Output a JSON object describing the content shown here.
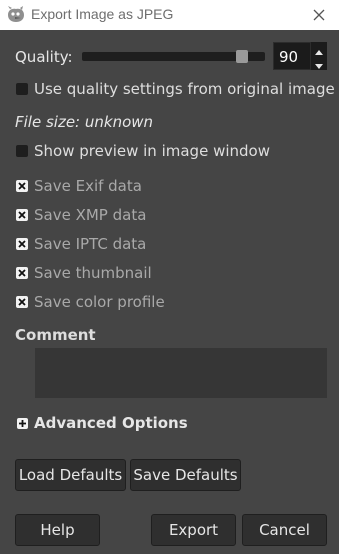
{
  "window": {
    "title": "Export Image as JPEG",
    "app_icon": "gimp-wilber-icon",
    "close_icon": "close-icon"
  },
  "quality": {
    "label": "Quality:",
    "value": "90",
    "slider_value": 90,
    "slider_min": 0,
    "slider_max": 100
  },
  "options": {
    "use_original_quality": {
      "label": "Use quality settings from original image",
      "checked": false
    },
    "file_size": "File size: unknown",
    "show_preview": {
      "label": "Show preview in image window",
      "checked": false
    },
    "save_exif": {
      "label": "Save Exif data",
      "checked": true
    },
    "save_xmp": {
      "label": "Save XMP data",
      "checked": true
    },
    "save_iptc": {
      "label": "Save IPTC data",
      "checked": true
    },
    "save_thumbnail": {
      "label": "Save thumbnail",
      "checked": true
    },
    "save_color_profile": {
      "label": "Save color profile",
      "checked": true
    }
  },
  "comment": {
    "label": "Comment",
    "value": ""
  },
  "advanced": {
    "label": "Advanced Options",
    "expanded": false
  },
  "buttons": {
    "load_defaults": "Load Defaults",
    "save_defaults": "Save Defaults",
    "help": "Help",
    "export": "Export",
    "cancel": "Cancel"
  },
  "colors": {
    "background": "#454545",
    "titlebar": "#ffffff",
    "field": "#1b1b1b",
    "button": "#2f2f2f"
  }
}
